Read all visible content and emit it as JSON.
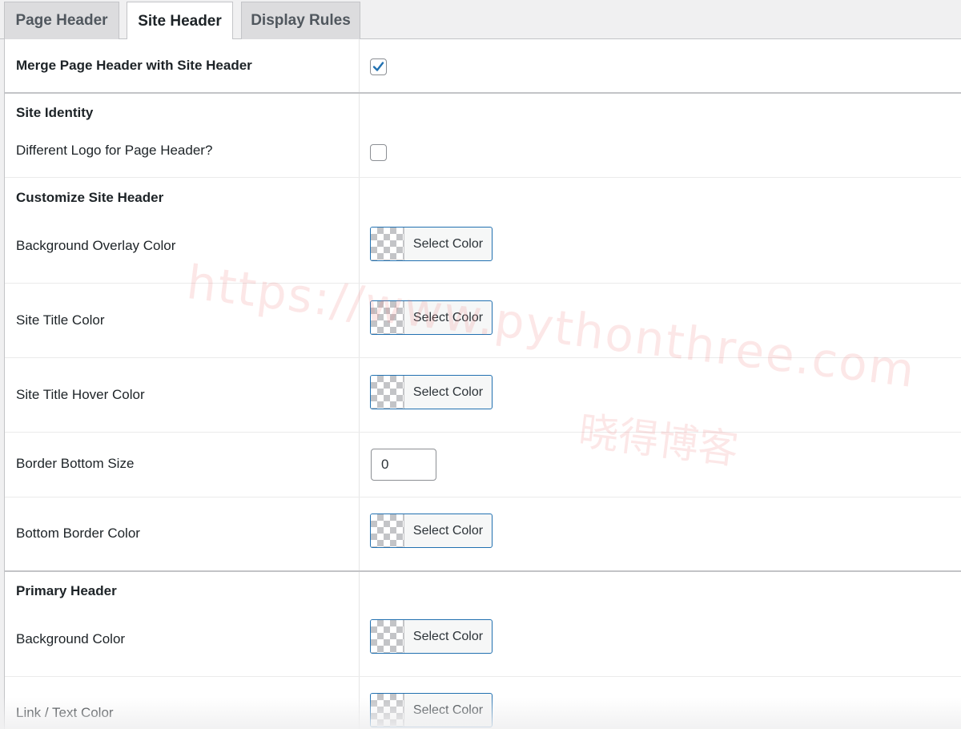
{
  "tabs": [
    {
      "label": "Page Header",
      "active": false
    },
    {
      "label": "Site Header",
      "active": true
    },
    {
      "label": "Display Rules",
      "active": false
    }
  ],
  "settings": {
    "merge": {
      "label": "Merge Page Header with Site Header",
      "checked": true
    },
    "site_identity": {
      "heading": "Site Identity",
      "different_logo": {
        "label": "Different Logo for Page Header?",
        "checked": false
      }
    },
    "customize": {
      "heading": "Customize Site Header",
      "bg_overlay": {
        "label": "Background Overlay Color",
        "button": "Select Color"
      },
      "site_title_color": {
        "label": "Site Title Color",
        "button": "Select Color"
      },
      "site_title_hover": {
        "label": "Site Title Hover Color",
        "button": "Select Color"
      },
      "border_bottom_size": {
        "label": "Border Bottom Size",
        "value": "0"
      },
      "bottom_border_color": {
        "label": "Bottom Border Color",
        "button": "Select Color"
      }
    },
    "primary": {
      "heading": "Primary Header",
      "background_color": {
        "label": "Background Color",
        "button": "Select Color"
      },
      "link_text_color": {
        "label": "Link / Text Color",
        "button": "Select Color"
      }
    }
  },
  "watermark": {
    "url": "https://www.pythonthree.com",
    "name": "晓得博客"
  },
  "colors": {
    "accent": "#2271b1",
    "border": "#c3c4c7",
    "tab_bg": "#dcdcde",
    "page_bg": "#f0f0f1"
  }
}
